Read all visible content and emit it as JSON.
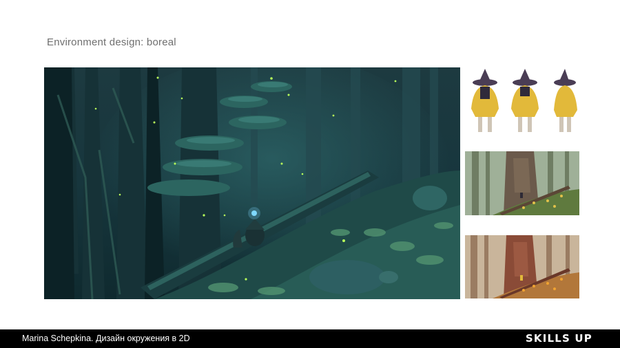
{
  "slide": {
    "title": "Environment design: boreal"
  },
  "artworks": {
    "main": {
      "subject": "dark teal boreal forest, fallen log, shelf fungi, glowing fireflies, small hooded figure with lantern"
    },
    "character_sheet": {
      "subject": "three views of character in yellow cloak and dark witch hat"
    },
    "thumbnail_1": {
      "subject": "muted green forest with fallen log and tiny figure"
    },
    "thumbnail_2": {
      "subject": "warm orange autumn forest with fallen log and tiny figure"
    }
  },
  "footer": {
    "credit": "Marina Schepkina. Дизайн окружения в 2D",
    "logo": "SKILLS UP"
  },
  "colors": {
    "footer_bg": "#000000",
    "title_text": "#6f6f6f",
    "forest_dark": "#0f2a30",
    "cloak_yellow": "#e2b93a"
  }
}
